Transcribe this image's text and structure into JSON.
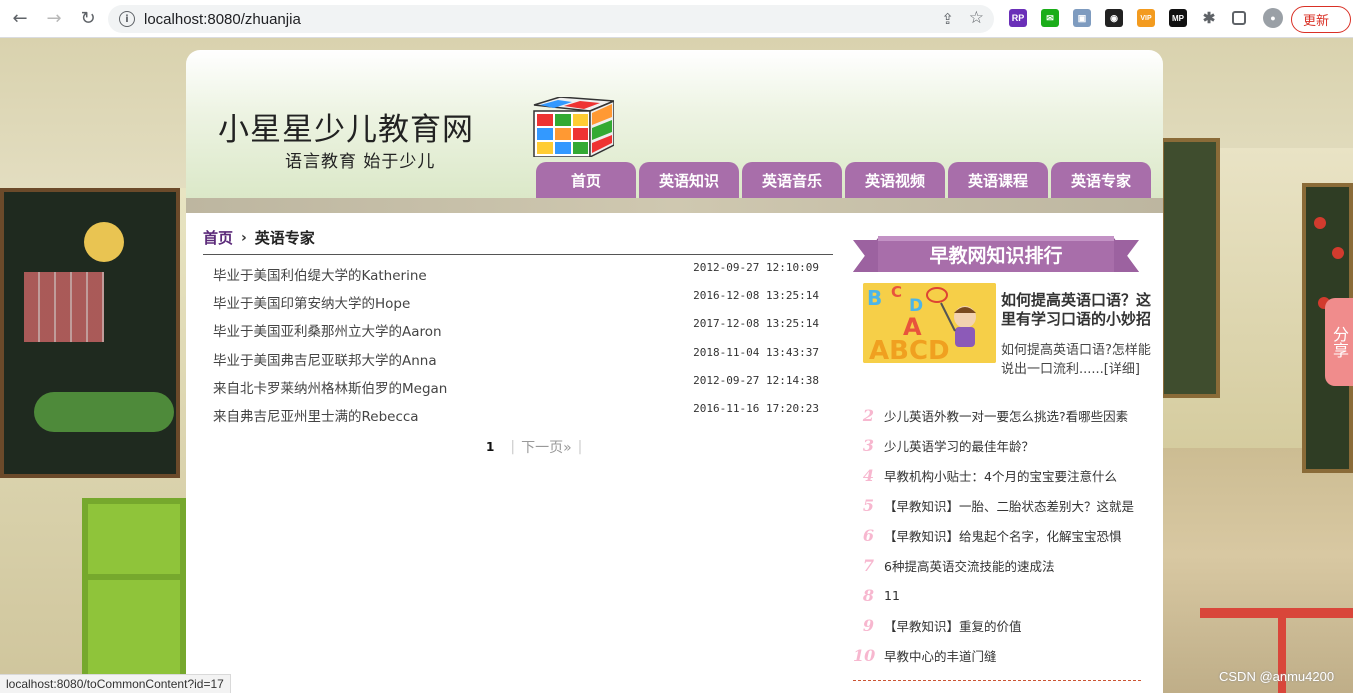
{
  "browser": {
    "url": "localhost:8080/zhuanjia",
    "update_label": "更新",
    "status_url": "localhost:8080/toCommonContent?id=17",
    "extensions": [
      {
        "name": "rp-extension-icon",
        "label": "RP",
        "color": "#6a2fb8"
      },
      {
        "name": "chat-extension-icon",
        "label": "💬",
        "color": "#1aad19"
      },
      {
        "name": "image-extension-icon",
        "label": "🖼",
        "color": "#7e9bbf"
      },
      {
        "name": "cat-extension-icon",
        "label": "◉",
        "color": "#222222"
      },
      {
        "name": "vip-extension-icon",
        "label": "VIP",
        "color": "#f39b1f"
      },
      {
        "name": "mp-extension-icon",
        "label": "MP",
        "color": "#111111"
      }
    ]
  },
  "site": {
    "logo_main": "小星星少儿教育网",
    "logo_sub": "语言教育 始于少儿",
    "menu": [
      "首页",
      "英语知识",
      "英语音乐",
      "英语视频",
      "英语课程",
      "英语专家"
    ]
  },
  "breadcrumb": {
    "home": "首页",
    "current": "英语专家"
  },
  "articles": [
    {
      "title": "毕业于美国利伯缇大学的Katherine",
      "date": "2012-09-27 12:10:09"
    },
    {
      "title": "毕业于美国印第安纳大学的Hope",
      "date": "2016-12-08 13:25:14"
    },
    {
      "title": "毕业于美国亚利桑那州立大学的Aaron",
      "date": "2017-12-08 13:25:14"
    },
    {
      "title": "毕业于美国弗吉尼亚联邦大学的Anna",
      "date": "2018-11-04 13:43:37"
    },
    {
      "title": "来自北卡罗莱纳州格林斯伯罗的Megan",
      "date": "2012-09-27 12:14:38"
    },
    {
      "title": "来自弗吉尼亚州里士满的Rebecca",
      "date": "2016-11-16 17:20:23"
    }
  ],
  "pager": {
    "current": "1",
    "next": "下一页»"
  },
  "sidebar": {
    "title": "早教网知识排行",
    "featured": {
      "title": "如何提高英语口语？这里有学习口语的小妙招",
      "desc": "如何提高英语口语?怎样能说出一口流利......[详细]"
    },
    "ranking": [
      {
        "num": "2",
        "text": "少儿英语外教一对一要怎么挑选?看哪些因素"
      },
      {
        "num": "3",
        "text": "少儿英语学习的最佳年龄？"
      },
      {
        "num": "4",
        "text": "早教机构小贴士：4个月的宝宝要注意什么"
      },
      {
        "num": "5",
        "text": "【早教知识】一胎、二胎状态差别大？这就是"
      },
      {
        "num": "6",
        "text": "【早教知识】给鬼起个名字，化解宝宝恐惧"
      },
      {
        "num": "7",
        "text": "6种提高英语交流技能的速成法"
      },
      {
        "num": "8",
        "text": "11"
      },
      {
        "num": "9",
        "text": "【早教知识】重复的价值"
      },
      {
        "num": "10",
        "text": "早教中心的丰道门缝"
      }
    ]
  },
  "share_tab": "分享",
  "watermark": "CSDN @anmu4200",
  "colors": {
    "menu": "#a86eaa",
    "rank_number": "#f7b7cf",
    "breadcrumb_home": "#5b2a7a"
  }
}
